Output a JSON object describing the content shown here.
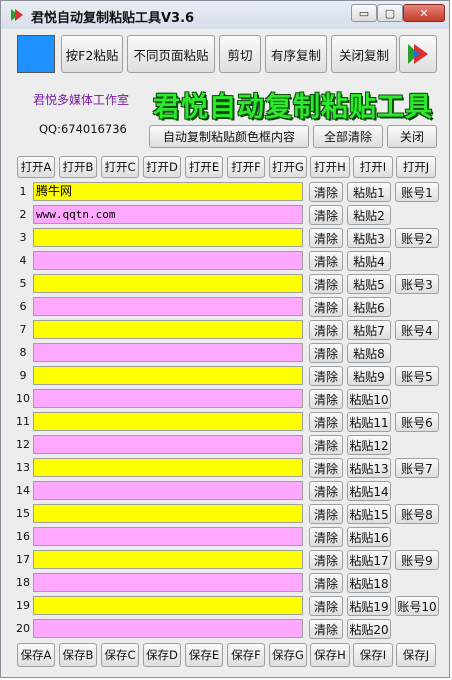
{
  "window": {
    "title": "君悦自动复制粘贴工具V3.6",
    "min_glyph": "▭",
    "max_glyph": "▢",
    "close_glyph": "✕"
  },
  "colors": {
    "swatch": "#1e90ff",
    "yellow": "#ffff00",
    "pink": "#ffa8ff",
    "banner": "#2ee82e",
    "studio": "#7a1aa8"
  },
  "toolbar": {
    "f2_paste": "按F2粘贴",
    "diff_page_paste": "不同页面粘贴",
    "cut": "剪切",
    "ordered_copy": "有序复制",
    "close_copy": "关闭复制"
  },
  "banner": "君悦自动复制粘贴工具",
  "studio": "君悦多媒体工作室",
  "qq": "QQ:674016736",
  "actions": {
    "box_color": "自动复制粘贴颜色框内容",
    "clear_all": "全部清除",
    "close": "关闭"
  },
  "open_buttons": [
    "打开A",
    "打开B",
    "打开C",
    "打开D",
    "打开E",
    "打开F",
    "打开G",
    "打开H",
    "打开I",
    "打开J"
  ],
  "save_buttons": [
    "保存A",
    "保存B",
    "保存C",
    "保存D",
    "保存E",
    "保存F",
    "保存G",
    "保存H",
    "保存I",
    "保存J"
  ],
  "clear_label": "清除",
  "rows": [
    {
      "num": "1",
      "value": "腾牛网",
      "paste": "粘贴1",
      "account": "账号1"
    },
    {
      "num": "2",
      "value": "www.qqtn.com",
      "paste": "粘贴2",
      "account": ""
    },
    {
      "num": "3",
      "value": "",
      "paste": "粘贴3",
      "account": "账号2"
    },
    {
      "num": "4",
      "value": "",
      "paste": "粘贴4",
      "account": ""
    },
    {
      "num": "5",
      "value": "",
      "paste": "粘贴5",
      "account": "账号3"
    },
    {
      "num": "6",
      "value": "",
      "paste": "粘贴6",
      "account": ""
    },
    {
      "num": "7",
      "value": "",
      "paste": "粘贴7",
      "account": "账号4"
    },
    {
      "num": "8",
      "value": "",
      "paste": "粘贴8",
      "account": ""
    },
    {
      "num": "9",
      "value": "",
      "paste": "粘贴9",
      "account": "账号5"
    },
    {
      "num": "10",
      "value": "",
      "paste": "粘贴10",
      "account": ""
    },
    {
      "num": "11",
      "value": "",
      "paste": "粘贴11",
      "account": "账号6"
    },
    {
      "num": "12",
      "value": "",
      "paste": "粘贴12",
      "account": ""
    },
    {
      "num": "13",
      "value": "",
      "paste": "粘贴13",
      "account": "账号7"
    },
    {
      "num": "14",
      "value": "",
      "paste": "粘贴14",
      "account": ""
    },
    {
      "num": "15",
      "value": "",
      "paste": "粘贴15",
      "account": "账号8"
    },
    {
      "num": "16",
      "value": "",
      "paste": "粘贴16",
      "account": ""
    },
    {
      "num": "17",
      "value": "",
      "paste": "粘贴17",
      "account": "账号9"
    },
    {
      "num": "18",
      "value": "",
      "paste": "粘贴18",
      "account": ""
    },
    {
      "num": "19",
      "value": "",
      "paste": "粘贴19",
      "account": "账号10"
    },
    {
      "num": "20",
      "value": "",
      "paste": "粘贴20",
      "account": ""
    }
  ]
}
